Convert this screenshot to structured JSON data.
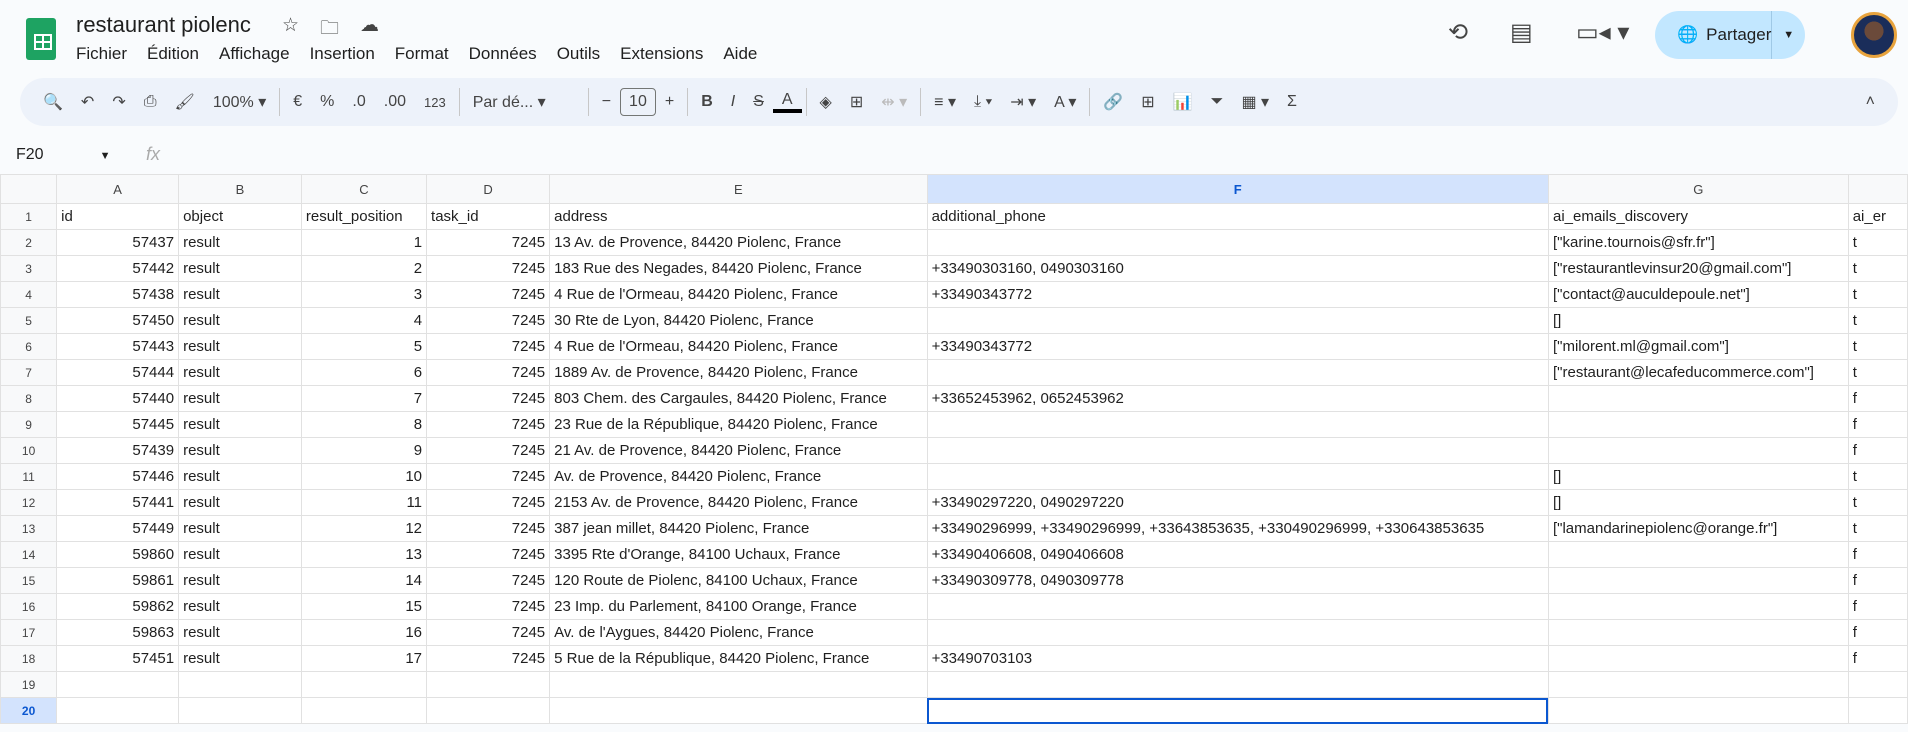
{
  "doc": {
    "title": "restaurant piolenc"
  },
  "menu": [
    "Fichier",
    "Édition",
    "Affichage",
    "Insertion",
    "Format",
    "Données",
    "Outils",
    "Extensions",
    "Aide"
  ],
  "share": {
    "label": "Partager"
  },
  "toolbar": {
    "zoom": "100%",
    "currency": "€",
    "percent": "%",
    "dec_dec": ".0",
    "inc_dec": ".00",
    "format_123": "123",
    "font": "Par dé...",
    "font_size": "10",
    "bold": "B",
    "italic": "I",
    "text_color": "A"
  },
  "formula_bar": {
    "name_box": "F20",
    "fx": "fx",
    "value": ""
  },
  "columns": [
    "A",
    "B",
    "C",
    "D",
    "E",
    "F",
    "G",
    ""
  ],
  "selected_cell": "F20",
  "rows": [
    [
      "id",
      "object",
      "result_position",
      "task_id",
      "address",
      "additional_phone",
      "ai_emails_discovery",
      "ai_er"
    ],
    [
      "57437",
      "result",
      "1",
      "7245",
      "13 Av. de Provence, 84420 Piolenc, France",
      "",
      "[\"karine.tournois@sfr.fr\"]",
      "t"
    ],
    [
      "57442",
      "result",
      "2",
      "7245",
      "183 Rue des Negades, 84420 Piolenc, France",
      "+33490303160, 0490303160",
      "[\"restaurantlevinsur20@gmail.com\"]",
      "t"
    ],
    [
      "57438",
      "result",
      "3",
      "7245",
      "4 Rue de l'Ormeau, 84420 Piolenc, France",
      "+33490343772",
      "[\"contact@auculdepoule.net\"]",
      "t"
    ],
    [
      "57450",
      "result",
      "4",
      "7245",
      "30 Rte de Lyon, 84420 Piolenc, France",
      "",
      "[]",
      "t"
    ],
    [
      "57443",
      "result",
      "5",
      "7245",
      "4 Rue de l'Ormeau, 84420 Piolenc, France",
      "+33490343772",
      "[\"milorent.ml@gmail.com\"]",
      "t"
    ],
    [
      "57444",
      "result",
      "6",
      "7245",
      "1889 Av. de Provence, 84420 Piolenc, France",
      "",
      "[\"restaurant@lecafeducommerce.com\"]",
      "t"
    ],
    [
      "57440",
      "result",
      "7",
      "7245",
      "803 Chem. des Cargaules, 84420 Piolenc, France",
      "+33652453962, 0652453962",
      "",
      "f"
    ],
    [
      "57445",
      "result",
      "8",
      "7245",
      "23 Rue de la République, 84420 Piolenc, France",
      "",
      "",
      "f"
    ],
    [
      "57439",
      "result",
      "9",
      "7245",
      "21 Av. de Provence, 84420 Piolenc, France",
      "",
      "",
      "f"
    ],
    [
      "57446",
      "result",
      "10",
      "7245",
      "Av. de Provence, 84420 Piolenc, France",
      "",
      "[]",
      "t"
    ],
    [
      "57441",
      "result",
      "11",
      "7245",
      "2153 Av. de Provence, 84420 Piolenc, France",
      "+33490297220, 0490297220",
      "[]",
      "t"
    ],
    [
      "57449",
      "result",
      "12",
      "7245",
      "387 jean millet, 84420 Piolenc, France",
      "+33490296999, +33490296999, +33643853635, +330490296999, +330643853635",
      "[\"lamandarinepiolenc@orange.fr\"]",
      "t"
    ],
    [
      "59860",
      "result",
      "13",
      "7245",
      "3395 Rte d'Orange, 84100 Uchaux, France",
      "+33490406608, 0490406608",
      "",
      "f"
    ],
    [
      "59861",
      "result",
      "14",
      "7245",
      "120 Route de Piolenc, 84100 Uchaux, France",
      "+33490309778, 0490309778",
      "",
      "f"
    ],
    [
      "59862",
      "result",
      "15",
      "7245",
      "23 Imp. du Parlement, 84100 Orange, France",
      "",
      "",
      "f"
    ],
    [
      "59863",
      "result",
      "16",
      "7245",
      "Av. de l'Aygues, 84420 Piolenc, France",
      "",
      "",
      "f"
    ],
    [
      "57451",
      "result",
      "17",
      "7245",
      "5 Rue de la République, 84420 Piolenc, France",
      "+33490703103",
      "",
      "f"
    ],
    [
      "",
      "",
      "",
      "",
      "",
      "",
      "",
      ""
    ],
    [
      "",
      "",
      "",
      "",
      "",
      "",
      "",
      ""
    ]
  ]
}
